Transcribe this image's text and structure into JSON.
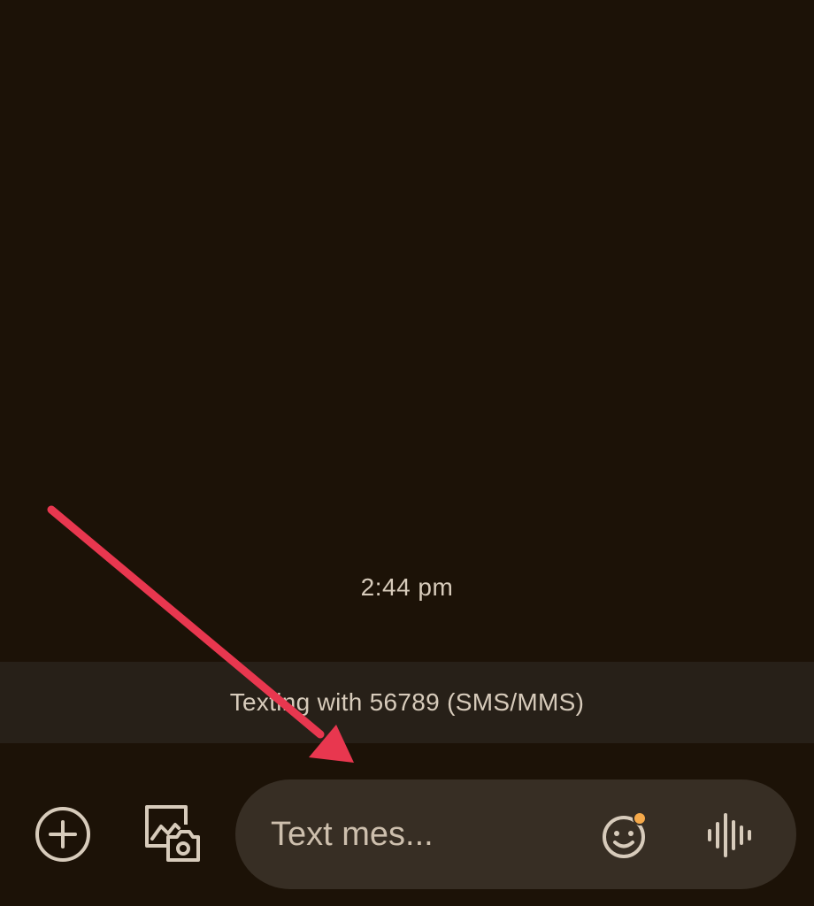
{
  "conversation": {
    "timestamp": "2:44 pm",
    "banner_text": "Texting with 56789 (SMS/MMS)"
  },
  "compose": {
    "placeholder": "Text mes..."
  },
  "icons": {
    "add": "add-circle-icon",
    "gallery": "gallery-camera-icon",
    "emoji": "emoji-icon",
    "voice": "voice-waveform-icon",
    "annotation": "red-arrow-annotation"
  },
  "colors": {
    "background": "#1c1207",
    "banner": "#272018",
    "compose_field": "#372e24",
    "text": "#d7cbbb",
    "emoji_badge": "#f5a94a",
    "annotation_arrow": "#e8374f"
  }
}
